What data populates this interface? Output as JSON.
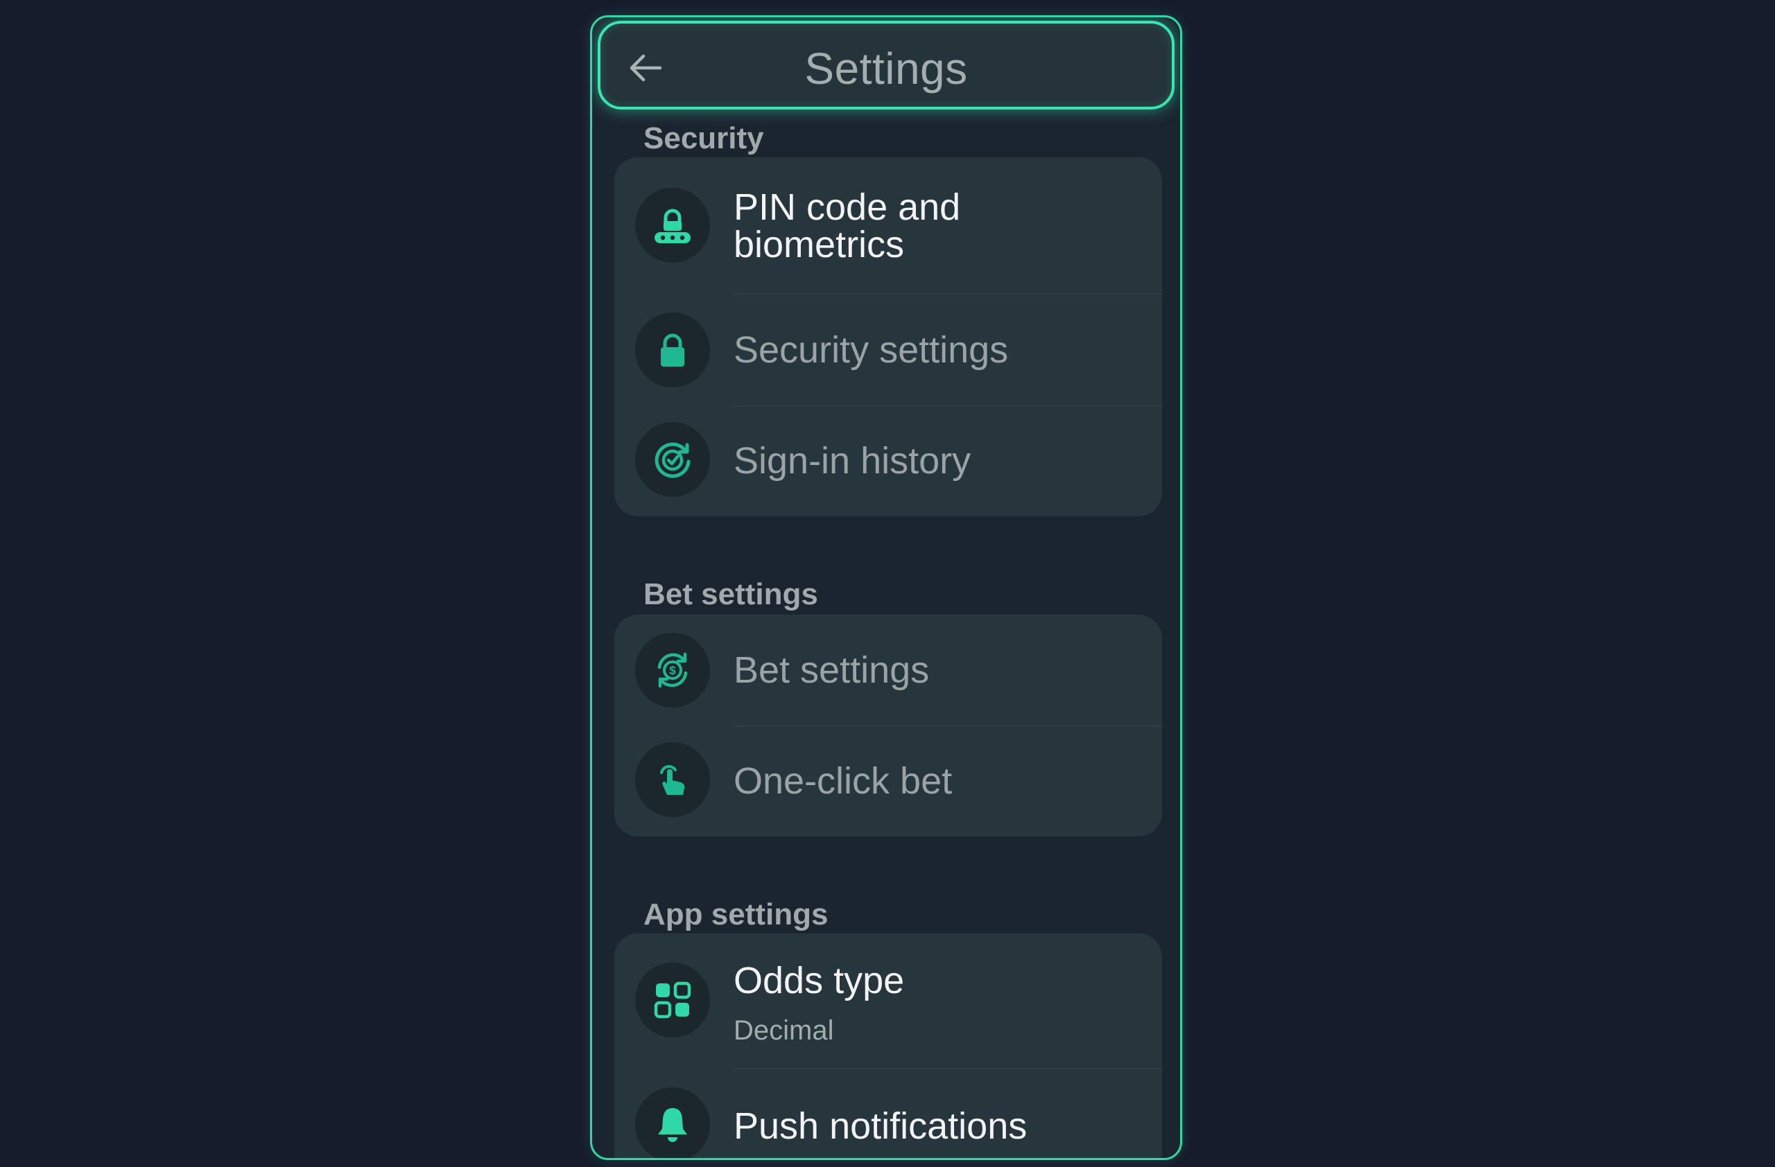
{
  "header": {
    "title": "Settings",
    "back_icon": "arrow-left-icon"
  },
  "colors": {
    "accent": "#2fd8a6",
    "background": "#171c2c",
    "card": "#27353c",
    "text_bright": "#f2f4f5",
    "text_dim": "#9aa4a7"
  },
  "sections": [
    {
      "title": "Security",
      "items": [
        {
          "label": "PIN code and biometrics",
          "label_line1": "PIN code and",
          "label_line2": "biometrics",
          "icon": "lock-pin-icon"
        },
        {
          "label": "Security settings",
          "icon": "lock-icon"
        },
        {
          "label": "Sign-in history",
          "icon": "history-check-icon"
        }
      ]
    },
    {
      "title": "Bet settings",
      "items": [
        {
          "label": "Bet settings",
          "icon": "dollar-refresh-icon"
        },
        {
          "label": "One-click bet",
          "icon": "tap-hand-icon"
        }
      ]
    },
    {
      "title": "App settings",
      "items": [
        {
          "label": "Odds type",
          "value": "Decimal",
          "icon": "grid-icon"
        },
        {
          "label": "Push notifications",
          "icon": "bell-icon"
        }
      ]
    }
  ]
}
